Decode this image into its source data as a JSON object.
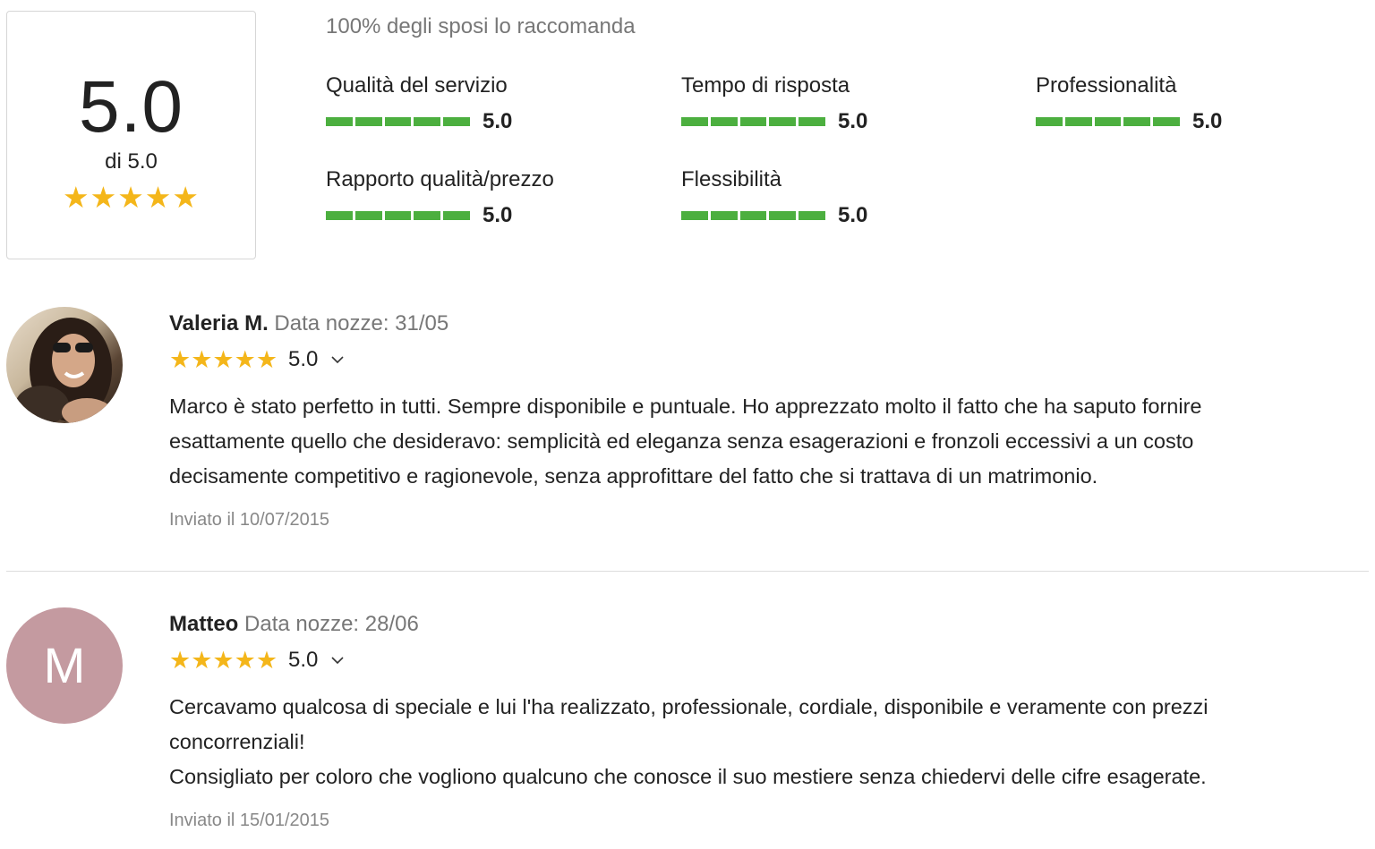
{
  "summary": {
    "score": "5.0",
    "out_of": "di 5.0",
    "stars": "★★★★★",
    "recommend_text": "100% degli sposi lo raccomanda"
  },
  "metrics": [
    {
      "label": "Qualità del servizio",
      "value": "5.0",
      "fill": 1.0
    },
    {
      "label": "Tempo di risposta",
      "value": "5.0",
      "fill": 1.0
    },
    {
      "label": "Professionalità",
      "value": "5.0",
      "fill": 1.0
    },
    {
      "label": "Rapporto qualità/prezzo",
      "value": "5.0",
      "fill": 1.0
    },
    {
      "label": "Flessibilità",
      "value": "5.0",
      "fill": 1.0
    }
  ],
  "reviews": [
    {
      "name": "Valeria M.",
      "wedding_date": "Data nozze: 31/05",
      "stars": "★★★★★",
      "score": "5.0",
      "avatar_type": "photo",
      "text_lines": [
        "Marco è stato perfetto in tutti. Sempre disponibile e puntuale. Ho apprezzato molto il fatto che ha saputo fornire",
        "esattamente quello che desideravo: semplicità ed eleganza senza esagerazioni e fronzoli eccessivi a un costo",
        "decisamente competitivo e ragionevole, senza approfittare del fatto che si trattava di un matrimonio."
      ],
      "sent": "Inviato il 10/07/2015"
    },
    {
      "name": "Matteo",
      "wedding_date": "Data nozze: 28/06",
      "stars": "★★★★★",
      "score": "5.0",
      "avatar_type": "initial",
      "avatar_initial": "M",
      "text_lines": [
        "Cercavamo qualcosa di speciale e lui l'ha realizzato, professionale, cordiale, disponibile e veramente con prezzi",
        "concorrenziali!",
        "Consigliato per coloro che vogliono qualcuno che conosce il suo mestiere senza chiedervi delle cifre esagerate."
      ],
      "sent": "Inviato il 15/01/2015"
    }
  ],
  "colors": {
    "bar": "#4caf3f",
    "star": "#f4b61a",
    "avatar_initial_bg": "#c49aa0",
    "muted_text": "#777777"
  },
  "icons": [
    "star-icon",
    "chevron-down-icon"
  ]
}
